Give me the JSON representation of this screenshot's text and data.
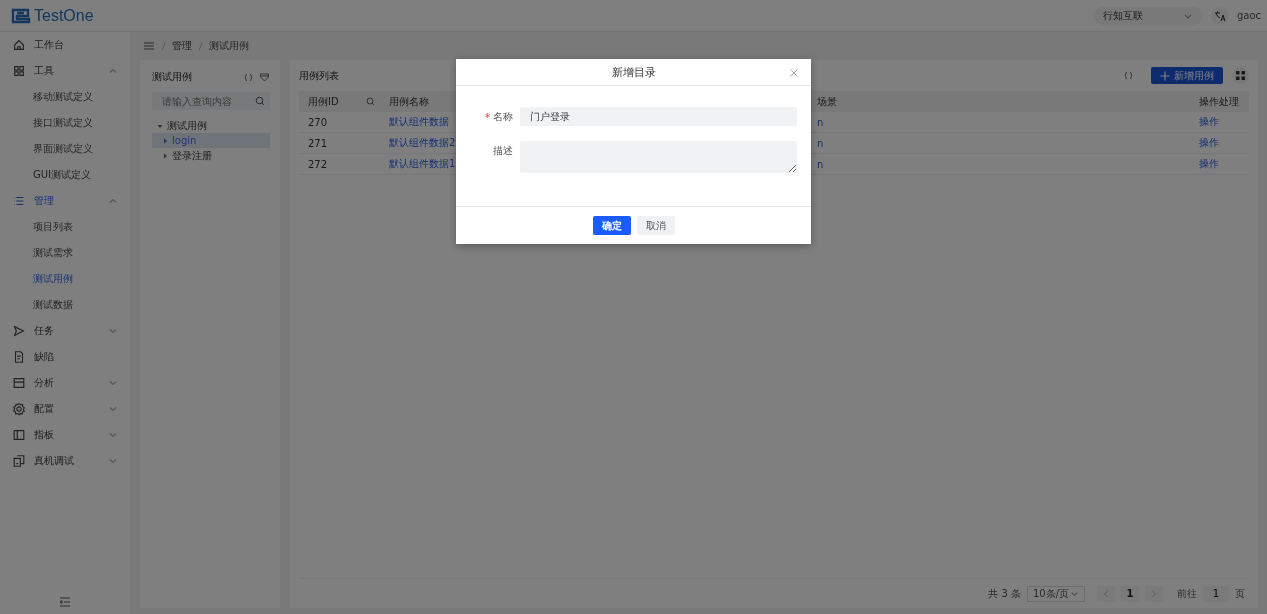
{
  "header": {
    "logo": "TestOne",
    "org_select": {
      "value": "行知互联"
    },
    "user": "gaoc"
  },
  "sidebar": {
    "items": [
      {
        "label": "工作台",
        "selected": false
      },
      {
        "label": "工具",
        "selected": false,
        "expanded": true,
        "children": [
          {
            "label": "移动测试定义",
            "selected": false
          },
          {
            "label": "接口测试定义",
            "selected": false
          },
          {
            "label": "界面测试定义",
            "selected": false
          },
          {
            "label": "GUI测试定义",
            "selected": false
          }
        ]
      },
      {
        "label": "管理",
        "selected": true,
        "expanded": true,
        "children": [
          {
            "label": "项目列表",
            "selected": false
          },
          {
            "label": "测试需求",
            "selected": false
          },
          {
            "label": "测试用例",
            "selected": true
          },
          {
            "label": "测试数据",
            "selected": false
          }
        ]
      },
      {
        "label": "任务",
        "selected": false,
        "expanded": false
      },
      {
        "label": "缺陷",
        "selected": false
      },
      {
        "label": "分析",
        "selected": false,
        "expanded": false
      },
      {
        "label": "配置",
        "selected": false,
        "expanded": false
      },
      {
        "label": "指板",
        "selected": false,
        "expanded": false
      },
      {
        "label": "真机调试",
        "selected": false,
        "expanded": false
      }
    ]
  },
  "breadcrumb": [
    "管理",
    "测试用例"
  ],
  "tree_panel": {
    "title": "测试用例",
    "search": {
      "placeholder": "请输入查询内容"
    },
    "tree": [
      {
        "label": "测试用例",
        "expanded": true,
        "selected": false,
        "children": [
          {
            "label": "login",
            "expanded": false,
            "selected": true
          },
          {
            "label": "登录注册",
            "expanded": false,
            "selected": false
          }
        ]
      }
    ]
  },
  "table_panel": {
    "title": "用例列表",
    "add_button": "新增用例",
    "columns": [
      "用例ID",
      "用例名称",
      "场景",
      "操作处理"
    ],
    "rows": [
      {
        "id": "270",
        "name": "默认组件数据",
        "column_3": "n",
        "action": "操作"
      },
      {
        "id": "271",
        "name": "默认组件数据2",
        "column_3": "n",
        "action": "操作"
      },
      {
        "id": "272",
        "name": "默认组件数据1",
        "column_3": "n",
        "action": "操作"
      }
    ],
    "pagination": {
      "total": "共 3 条",
      "page_size": "10条/页",
      "pages": [
        {
          "label": "1",
          "selected": true
        }
      ],
      "goto_label": "前往",
      "goto_value": "1",
      "goto_suffix": "页"
    }
  },
  "dialog": {
    "title": "新增目录",
    "fields": [
      {
        "kind": "input",
        "label": "名称",
        "required": true,
        "value": "门户登录"
      },
      {
        "kind": "textarea",
        "label": "描述",
        "required": false
      }
    ],
    "buttons": [
      {
        "label": "确定",
        "primary": true
      },
      {
        "label": "取消",
        "primary": false
      }
    ]
  }
}
